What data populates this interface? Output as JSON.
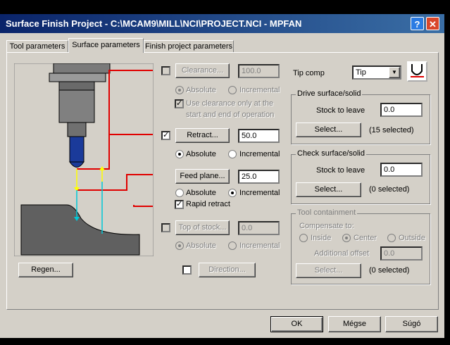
{
  "window": {
    "title": "Surface Finish Project - C:\\MCAM9\\MILL\\NCI\\PROJECT.NCI - MPFAN",
    "help_glyph": "?",
    "close_glyph": "✕"
  },
  "tabs": [
    {
      "label": "Tool parameters"
    },
    {
      "label": "Surface parameters"
    },
    {
      "label": "Finish project parameters"
    }
  ],
  "clearance": {
    "button": "Clearance...",
    "value": "100.0",
    "absolute": "Absolute",
    "incremental": "Incremental",
    "use_only": "Use clearance only at the",
    "use_only_2": "start and end of operation"
  },
  "retract": {
    "button": "Retract...",
    "value": "50.0",
    "absolute": "Absolute",
    "incremental": "Incremental"
  },
  "feed_plane": {
    "button": "Feed plane...",
    "value": "25.0",
    "absolute": "Absolute",
    "incremental": "Incremental",
    "rapid_retract": "Rapid retract"
  },
  "top_of_stock": {
    "button": "Top of stock...",
    "value": "0.0",
    "absolute": "Absolute",
    "incremental": "Incremental"
  },
  "direction_button": "Direction...",
  "regen_button": "Regen...",
  "tip_comp": {
    "label": "Tip comp",
    "value": "Tip",
    "arrow": "▼"
  },
  "drive": {
    "title": "Drive surface/solid",
    "stock_label": "Stock to leave",
    "stock_value": "0.0",
    "select_button": "Select...",
    "selected": "(15  selected)"
  },
  "check": {
    "title": "Check surface/solid",
    "stock_label": "Stock to leave",
    "stock_value": "0.0",
    "select_button": "Select...",
    "selected": "(0  selected)"
  },
  "containment": {
    "title": "Tool containment",
    "compensate": "Compensate to:",
    "inside": "Inside",
    "center": "Center",
    "outside": "Outside",
    "offset_label": "Additional offset",
    "offset_value": "0.0",
    "select_button": "Select...",
    "selected": "(0  selected)"
  },
  "footer": {
    "ok": "OK",
    "cancel": "Mégse",
    "help": "Súgó"
  },
  "colors": {
    "titlebar_start": "#0a246a",
    "dialog": "#d4d0c8",
    "diagram_bg": "#d4d0c8",
    "red_line": "#e00000",
    "yellow_arrow": "#ffff00",
    "cyan_arrow": "#00c8d8",
    "tool_body": "#707070"
  }
}
